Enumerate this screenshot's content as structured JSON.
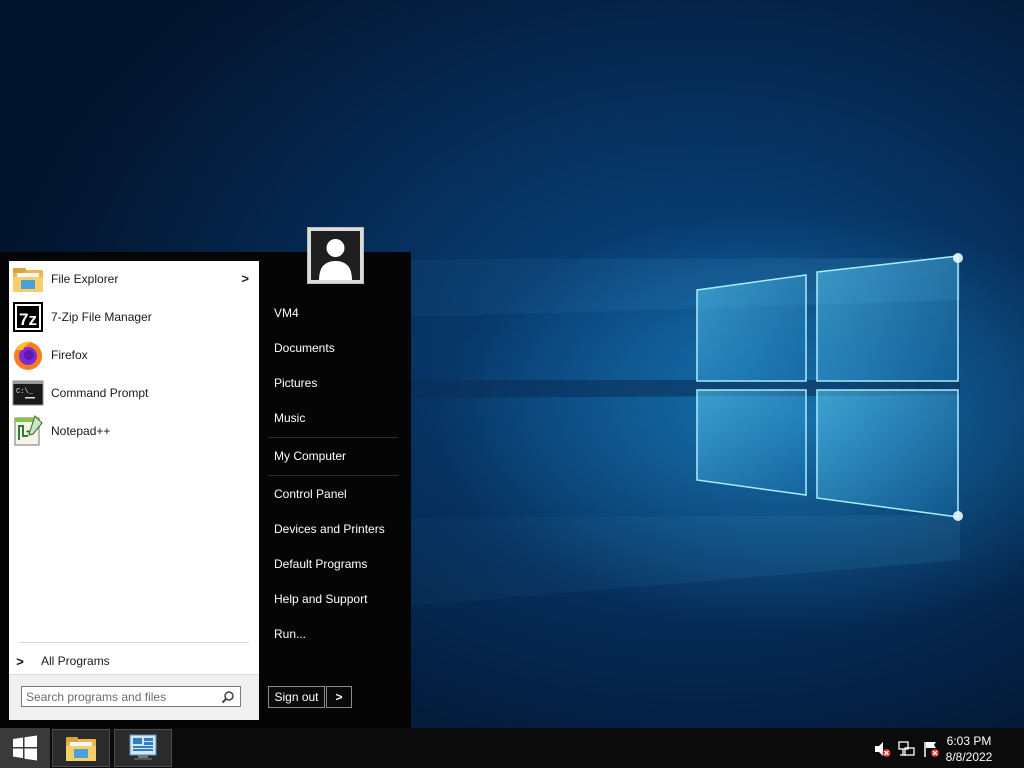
{
  "start_menu": {
    "pinned": [
      {
        "label": "File Explorer",
        "icon": "folder-icon",
        "has_submenu": true
      },
      {
        "label": "7-Zip File Manager",
        "icon": "seven-zip-icon",
        "has_submenu": false
      },
      {
        "label": "Firefox",
        "icon": "firefox-icon",
        "has_submenu": false
      },
      {
        "label": "Command Prompt",
        "icon": "command-prompt-icon",
        "has_submenu": false
      },
      {
        "label": "Notepad++",
        "icon": "notepad-plus-plus-icon",
        "has_submenu": false
      }
    ],
    "all_programs_label": "All Programs",
    "search": {
      "placeholder": "Search programs and files",
      "value": ""
    },
    "right_items": [
      {
        "label": "VM4"
      },
      {
        "label": "Documents"
      },
      {
        "label": "Pictures"
      },
      {
        "label": "Music"
      },
      {
        "label": "My Computer"
      },
      {
        "label": "Control Panel"
      },
      {
        "label": "Devices and Printers"
      },
      {
        "label": "Default Programs"
      },
      {
        "label": "Help and Support"
      },
      {
        "label": "Run..."
      }
    ],
    "sign_out_label": "Sign out",
    "sign_out_arrow": ">",
    "submenu_arrow": ">",
    "all_programs_arrow": ">"
  },
  "taskbar": {
    "items": [
      {
        "name": "file-explorer",
        "icon": "folder-icon"
      },
      {
        "name": "server-manager",
        "icon": "server-manager-icon"
      }
    ],
    "tray_icons": [
      "volume-muted-icon",
      "network-icon",
      "action-center-icon"
    ],
    "clock": {
      "time": "6:03 PM",
      "date": "8/8/2022"
    }
  },
  "colors": {
    "start_menu_bg": "#050505",
    "left_pane_bg": "#ffffff",
    "taskbar_bg": "#0b0b0b",
    "wallpaper_accent": "#2fa8e0"
  }
}
